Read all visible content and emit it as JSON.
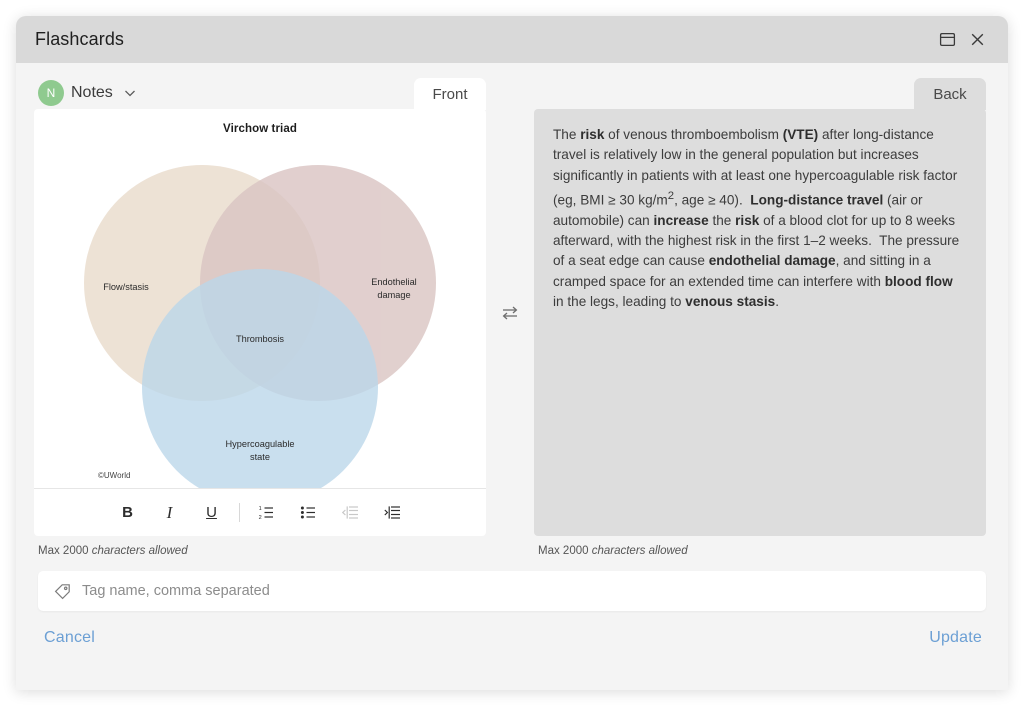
{
  "window": {
    "title": "Flashcards",
    "restore_icon": "window-restore-icon",
    "close_icon": "close-icon"
  },
  "notes": {
    "avatar_initial": "N",
    "label": "Notes",
    "chevron_icon": "chevron-down-icon"
  },
  "tabs": {
    "front": "Front",
    "back": "Back"
  },
  "swap": {
    "icon": "swap-arrows-icon"
  },
  "front": {
    "char_hint_prefix": "Max 2000",
    "char_hint_suffix": "characters allowed",
    "image": {
      "title": "Virchow triad",
      "labels": {
        "flow": "Flow/stasis",
        "endothelial_line1": "Endothelial",
        "endothelial_line2": "damage",
        "center": "Thrombosis",
        "hyper_line1": "Hypercoagulable",
        "hyper_line2": "state"
      },
      "copyright": "©UWorld",
      "colors": {
        "flow_circle": "#ece0d2",
        "endothelial_circle": "#ddc9c8",
        "hypercoagulable_circle": "#c7dcec"
      }
    },
    "toolbar": [
      {
        "name": "bold-icon",
        "glyph": "B",
        "disabled": false
      },
      {
        "name": "italic-icon",
        "glyph": "I",
        "disabled": false
      },
      {
        "name": "underline-icon",
        "glyph": "U",
        "disabled": false
      },
      {
        "name": "numbered-list-icon",
        "glyph": "",
        "disabled": false
      },
      {
        "name": "bulleted-list-icon",
        "glyph": "",
        "disabled": false
      },
      {
        "name": "outdent-icon",
        "glyph": "",
        "disabled": true
      },
      {
        "name": "indent-icon",
        "glyph": "",
        "disabled": false
      }
    ]
  },
  "back": {
    "char_hint_prefix": "Max 2000",
    "char_hint_suffix": "characters allowed",
    "paragraph_html": "The <b>risk</b> of venous thromboembolism <b>(VTE)</b> after long-distance travel is relatively low in the general population but increases significantly in patients with at least one hypercoagulable risk factor (eg, BMI &#8805; 30 kg/m<sup>2</sup>, age &#8805; 40).&nbsp; <b>Long-distance travel</b> (air or automobile) can <b>increase</b> the <b>risk</b> of a blood clot for up to 8 weeks afterward, with the highest risk in the first 1&#8211;2 weeks.&nbsp; The pressure of a seat edge can cause <b>endothelial damage</b>, and sitting in a cramped space for an extended time can interfere with <b>blood flow</b> in the legs, leading to <b>venous stasis</b>."
  },
  "tag_field": {
    "placeholder": "Tag name, comma separated",
    "value": "",
    "icon": "tag-icon"
  },
  "footer": {
    "cancel_label": "Cancel",
    "update_label": "Update",
    "link_color": "#6b9fd4"
  }
}
